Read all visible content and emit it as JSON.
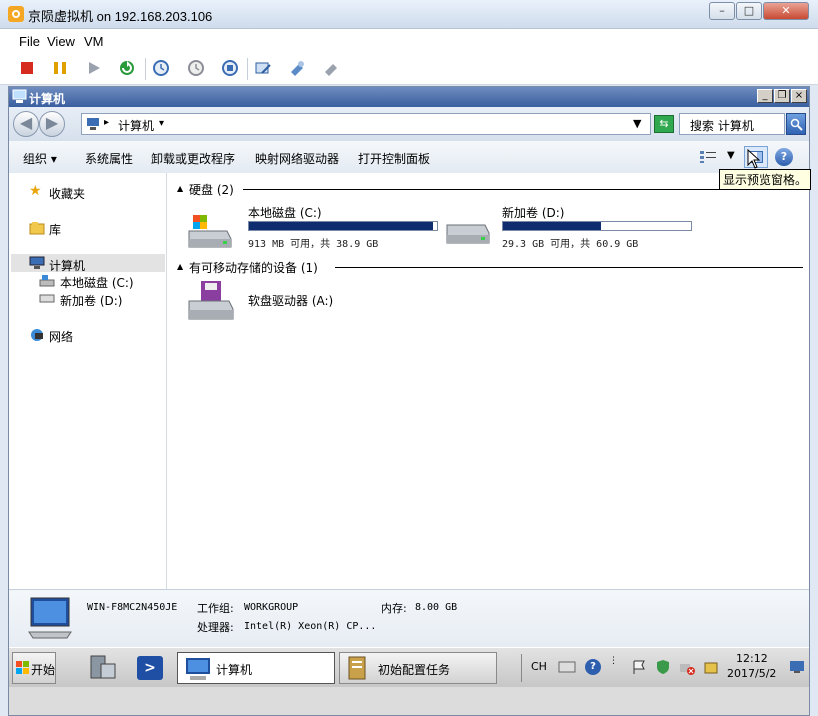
{
  "host": {
    "title": "京陨虚拟机 on 192.168.203.106",
    "menu": [
      "File",
      "View",
      "VM"
    ],
    "toolbar_icons": [
      "stop-icon",
      "pause-icon",
      "play-icon",
      "reset-icon",
      "snapshot-icon",
      "revert-snapshot-icon",
      "manage-snapshot-icon",
      "edit-settings-icon",
      "console-options-icon",
      "send-keys-icon"
    ]
  },
  "guest": {
    "window_title": "计算机",
    "address": {
      "path": "计算机",
      "sep": "▸"
    },
    "search_placeholder": "搜索 计算机",
    "commands": [
      "组织 ▾",
      "系统属性",
      "卸载或更改程序",
      "映射网络驱动器",
      "打开控制面板"
    ],
    "tooltip": "显示预览窗格。",
    "nav": {
      "favorites": "收藏夹",
      "libraries": "库",
      "computer": "计算机",
      "drive_c": "本地磁盘 (C:)",
      "drive_d": "新加卷 (D:)",
      "network": "网络"
    },
    "groups": {
      "hdd": "硬盘 (2)",
      "removable": "有可移动存储的设备 (1)"
    },
    "drives": [
      {
        "name": "本地磁盘 (C:)",
        "info": "913 MB 可用，共 38.9 GB",
        "used_fraction": 0.977
      },
      {
        "name": "新加卷 (D:)",
        "info": "29.3 GB 可用，共 60.9 GB",
        "used_fraction": 0.519
      }
    ],
    "removable": [
      {
        "name": "软盘驱动器 (A:)"
      }
    ],
    "details": {
      "computer_name": "WIN-F8MC2N450JE",
      "workgroup_label": "工作组:",
      "workgroup": "WORKGROUP",
      "memory_label": "内存:",
      "memory": "8.00 GB",
      "cpu_label": "处理器:",
      "cpu": "Intel(R) Xeon(R) CP..."
    },
    "taskbar": {
      "start": "开始",
      "task1": "计算机",
      "task2": "初始配置任务",
      "lang": "CH",
      "time": "12:12",
      "date": "2017/5/2"
    }
  },
  "colors": {
    "accent": "#0e2d6e",
    "titlebar": "#3a5ea0"
  }
}
